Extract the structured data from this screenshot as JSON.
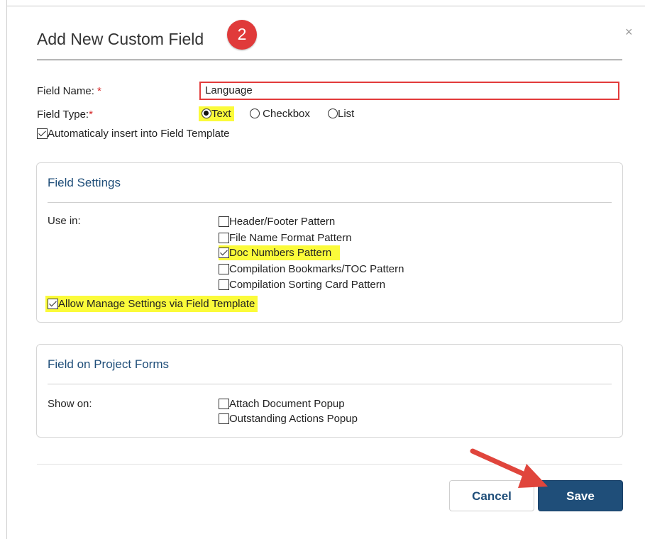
{
  "dialog": {
    "title": "Add New Custom Field",
    "step_badge": "2",
    "close_glyph": "×"
  },
  "form": {
    "field_name_label": "Field Name:",
    "required_mark": "*",
    "field_name_value": "Language",
    "field_type_label": "Field Type:",
    "field_type_options": [
      {
        "label": "Text",
        "selected": true
      },
      {
        "label": "Checkbox",
        "selected": false
      },
      {
        "label": "List",
        "selected": false
      }
    ],
    "auto_insert_label": "Automaticaly insert into Field Template",
    "auto_insert_checked": true
  },
  "field_settings": {
    "title": "Field Settings",
    "use_in_label": "Use in:",
    "options": [
      {
        "label": "Header/Footer Pattern",
        "checked": false
      },
      {
        "label": "File Name Format Pattern",
        "checked": false
      },
      {
        "label": "Doc Numbers Pattern",
        "checked": true
      },
      {
        "label": "Compilation Bookmarks/TOC Pattern",
        "checked": false
      },
      {
        "label": "Compilation Sorting Card Pattern",
        "checked": false
      }
    ],
    "allow_manage_label": "Allow Manage Settings via Field Template",
    "allow_manage_checked": true
  },
  "project_forms": {
    "title": "Field on Project Forms",
    "show_on_label": "Show on:",
    "options": [
      {
        "label": "Attach Document Popup",
        "checked": false
      },
      {
        "label": "Outstanding Actions Popup",
        "checked": false
      }
    ]
  },
  "footer": {
    "cancel_label": "Cancel",
    "save_label": "Save"
  },
  "colors": {
    "accent": "#1f4e79",
    "badge": "#e03a3a",
    "highlight": "#fbfb3a",
    "annotation_arrow": "#e0453c"
  }
}
